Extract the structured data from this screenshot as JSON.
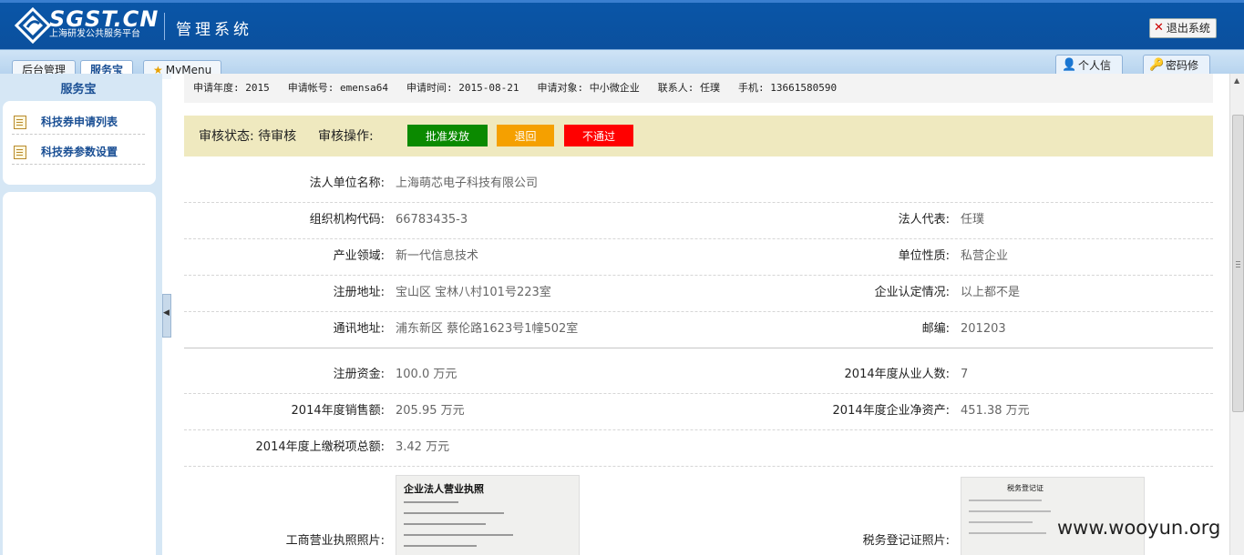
{
  "header": {
    "logo_text": "SGST.CN",
    "logo_subtitle": "上海研发公共服务平台",
    "system_title": "管理系统",
    "logout_label": "退出系统"
  },
  "tabs": [
    {
      "label": "后台管理"
    },
    {
      "label": "服务宝"
    },
    {
      "label": "MyMenu"
    }
  ],
  "right_tabs": [
    {
      "label": "个人信"
    },
    {
      "label": "密码修"
    }
  ],
  "sidebar": {
    "title": "服务宝",
    "items": [
      {
        "label": "科技券申请列表"
      },
      {
        "label": "科技券参数设置"
      }
    ]
  },
  "info": {
    "year": "申请年度: 2015",
    "account": "申请帐号: emensa64",
    "date": "申请时间: 2015-08-21",
    "target": "申请对象: 中小微企业",
    "contact": "联系人: 任璞",
    "phone": "手机: 13661580590"
  },
  "review": {
    "status_label": "审核状态: 待审核",
    "ops_label": "审核操作:",
    "approve": "批准发放",
    "return": "退回",
    "reject": "不通过"
  },
  "fields": {
    "company_name_label": "法人单位名称:",
    "company_name": "上海萌芯电子科技有限公司",
    "org_code_label": "组织机构代码:",
    "org_code": "66783435-3",
    "legal_rep_label": "法人代表:",
    "legal_rep": "任璞",
    "industry_label": "产业领域:",
    "industry": "新一代信息技术",
    "nature_label": "单位性质:",
    "nature": "私营企业",
    "reg_addr_label": "注册地址:",
    "reg_addr": "宝山区 宝林八村101号223室",
    "cert_label": "企业认定情况:",
    "cert": "以上都不是",
    "mail_addr_label": "通讯地址:",
    "mail_addr": "浦东新区 蔡伦路1623号1幢502室",
    "zip_label": "邮编:",
    "zip": "201203",
    "capital_label": "注册资金:",
    "capital": "100.0 万元",
    "employees_label": "2014年度从业人数:",
    "employees": "7",
    "sales_label": "2014年度销售额:",
    "sales": "205.95 万元",
    "net_assets_label": "2014年度企业净资产:",
    "net_assets": "451.38 万元",
    "tax_label": "2014年度上缴税项总额:",
    "tax": "3.42 万元",
    "license_label": "工商营业执照照片:",
    "tax_cert_label": "税务登记证照片:",
    "license_photo_title": "企业法人营业执照",
    "tax_photo_title": "税务登记证"
  },
  "watermark": "www.wooyun.org",
  "colors": {
    "approve": "#0b8a00",
    "return": "#f5a000",
    "reject": "#ff0000",
    "header": "#0b52a0"
  }
}
